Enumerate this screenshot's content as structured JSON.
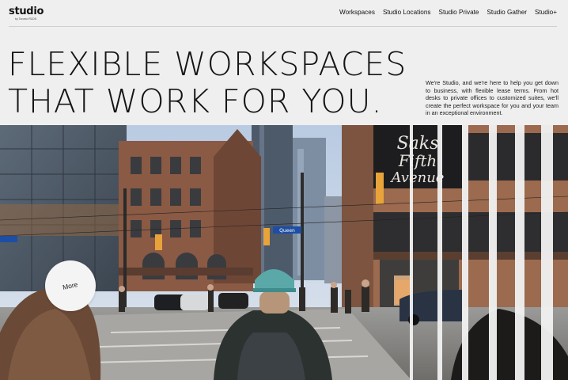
{
  "brand": {
    "logo": "studio",
    "logo_sub": "by Toronto RCDS"
  },
  "nav": {
    "items": [
      {
        "label": "Workspaces",
        "name": "nav-workspaces"
      },
      {
        "label": "Studio Locations",
        "name": "nav-studio-locations"
      },
      {
        "label": "Studio Private",
        "name": "nav-studio-private"
      },
      {
        "label": "Studio Gather",
        "name": "nav-studio-gather"
      },
      {
        "label": "Studio+",
        "name": "nav-studio-plus"
      }
    ]
  },
  "hero": {
    "headline_line1": "FLEXIBLE WORKSPACES",
    "headline_line2": "THAT WORK FOR YOU.",
    "intro": "We're Studio, and we're here to help you get down to business, with flexible lease terms. From hot desks to private offices to customized suites, we'll create the perfect workspace for you and your team in an exceptional environment.",
    "more_label": "More"
  },
  "photo": {
    "sign_line1": "Saks",
    "sign_line2": "Fifth",
    "sign_line3": "Avenue",
    "street_sign": "Queen"
  },
  "colors": {
    "background": "#efefef",
    "text": "#111111",
    "sky": "#c9d6e6",
    "brick": "#8a5a44"
  }
}
